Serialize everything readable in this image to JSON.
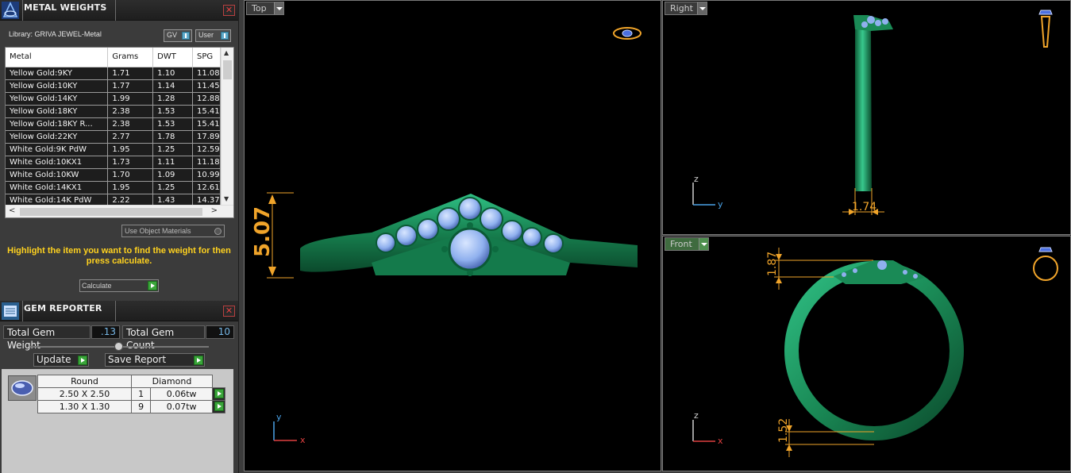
{
  "metal_weights": {
    "title": "METAL WEIGHTS",
    "library_label": "Library: GRIVA JEWEL-Metal",
    "toggle_gv": "GV",
    "toggle_user": "User",
    "columns": [
      "Metal",
      "Grams",
      "DWT",
      "SPG"
    ],
    "rows": [
      [
        "Yellow Gold:9KY",
        "1.71",
        "1.10",
        "11.08"
      ],
      [
        "Yellow Gold:10KY",
        "1.77",
        "1.14",
        "11.45"
      ],
      [
        "Yellow Gold:14KY",
        "1.99",
        "1.28",
        "12.88"
      ],
      [
        "Yellow Gold:18KY",
        "2.38",
        "1.53",
        "15.41"
      ],
      [
        "Yellow Gold:18KY R...",
        "2.38",
        "1.53",
        "15.41"
      ],
      [
        "Yellow Gold:22KY",
        "2.77",
        "1.78",
        "17.89"
      ],
      [
        "White Gold:9K PdW",
        "1.95",
        "1.25",
        "12.59"
      ],
      [
        "White Gold:10KX1",
        "1.73",
        "1.11",
        "11.18"
      ],
      [
        "White Gold:10KW",
        "1.70",
        "1.09",
        "10.99"
      ],
      [
        "White Gold:14KX1",
        "1.95",
        "1.25",
        "12.61"
      ],
      [
        "White Gold:14K PdW",
        "2.22",
        "1.43",
        "14.37"
      ]
    ],
    "use_object_materials": "Use Object Materials",
    "hint": "Highlight the item you want to find the weight for then press calculate.",
    "calculate_label": "Calculate"
  },
  "gem_reporter": {
    "title": "GEM REPORTER",
    "total_weight_label": "Total Gem Weight",
    "total_weight_value": ".13",
    "total_count_label": "Total Gem Count",
    "total_count_value": "10",
    "update_label": "Update",
    "save_report_label": "Save Report",
    "shape_header": "Round",
    "material_header": "Diamond",
    "gems": [
      {
        "size": "2.50 X 2.50",
        "count": "1",
        "weight": "0.06tw"
      },
      {
        "size": "1.30 X 1.30",
        "count": "9",
        "weight": "0.07tw"
      }
    ]
  },
  "viewports": {
    "top": {
      "label": "Top",
      "dimension": "5.07",
      "axis_a": "y",
      "axis_b": "x"
    },
    "right": {
      "label": "Right",
      "dimension": "1.74",
      "axis_a": "z",
      "axis_b": "y"
    },
    "front": {
      "label": "Front",
      "dimension_top": "1.87",
      "dimension_bottom": "1.52",
      "axis_a": "z",
      "axis_b": "x"
    }
  },
  "colors": {
    "ring_green": "#1f9a64",
    "gem_blue": "#8fb0ee",
    "dimension_orange": "#f0a42a",
    "hint_yellow": "#ffd21f"
  }
}
